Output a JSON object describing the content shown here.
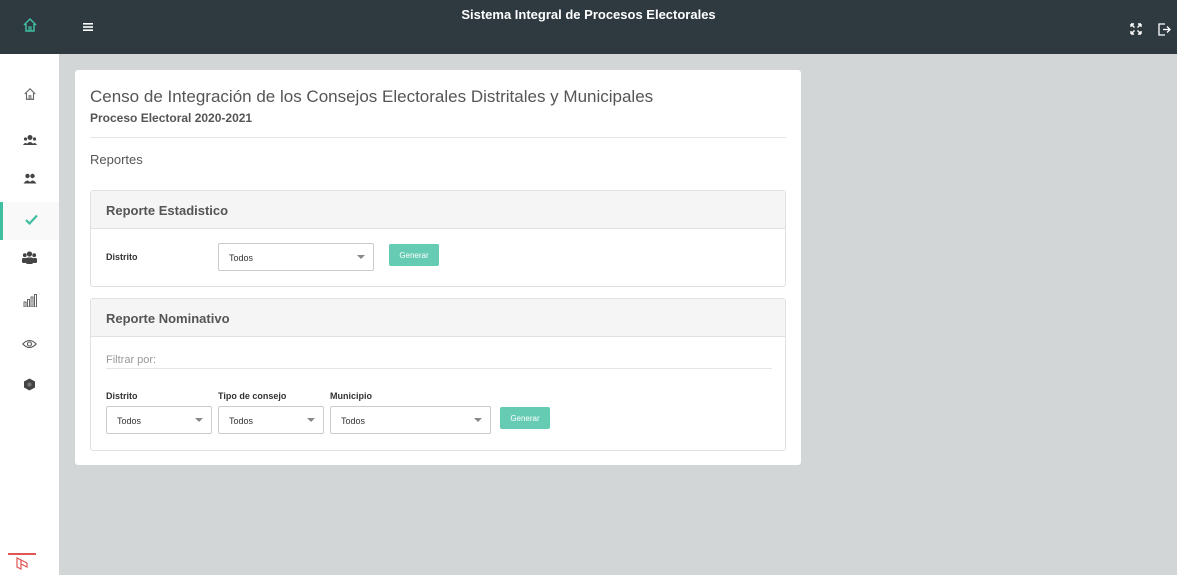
{
  "app": {
    "title": "Sistema Integral de Procesos Electorales"
  },
  "sidebar": {
    "items": [
      {
        "icon": "home-icon"
      },
      {
        "icon": "user-group-icon"
      },
      {
        "icon": "people-icon"
      },
      {
        "icon": "check-icon",
        "active": true
      },
      {
        "icon": "team-icon"
      },
      {
        "icon": "bar-chart-icon"
      },
      {
        "icon": "eye-icon"
      },
      {
        "icon": "hexagon-icon"
      }
    ]
  },
  "page": {
    "title": "Censo de Integración de los Consejos Electorales Distritales y Municipales",
    "subtitle": "Proceso Electoral 2020-2021",
    "section": "Reportes"
  },
  "reporte_estadistico": {
    "title": "Reporte Estadistico",
    "distrito_label": "Distrito",
    "distrito_value": "Todos",
    "button": "Generar"
  },
  "reporte_nominativo": {
    "title": "Reporte Nominativo",
    "filter_placeholder": "Filtrar por:",
    "distrito_label": "Distrito",
    "distrito_value": "Todos",
    "tipo_label": "Tipo de consejo",
    "tipo_value": "Todos",
    "municipio_label": "Municipio",
    "municipio_value": "Todos",
    "button": "Generar"
  },
  "colors": {
    "topbar": "#2f3a40",
    "accent": "#3fbfa0",
    "button": "#66cbb3",
    "background": "#d2d6d6"
  }
}
